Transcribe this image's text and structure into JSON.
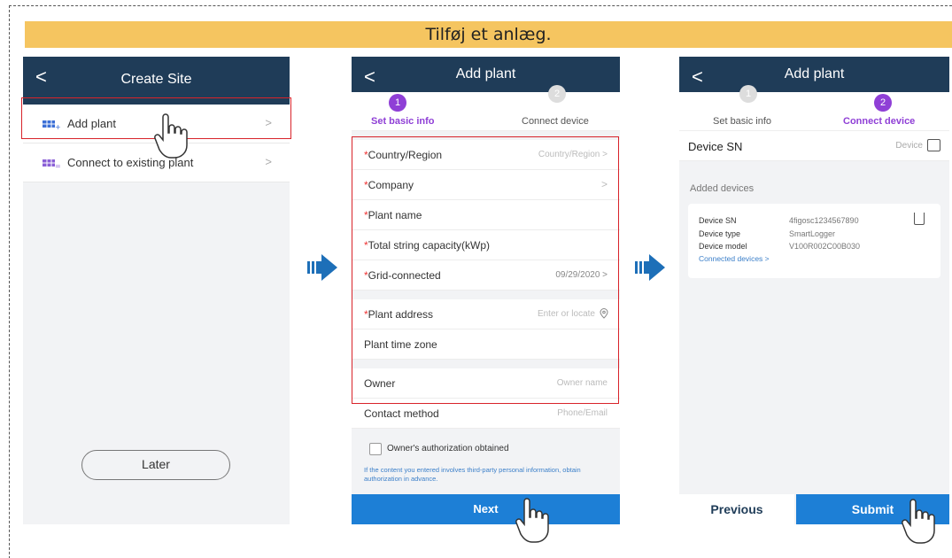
{
  "banner": "Tilføj et anlæg.",
  "screen1": {
    "title": "Create Site",
    "back": "<",
    "items": [
      {
        "label": "Add plant",
        "chev": ">"
      },
      {
        "label": "Connect to existing plant",
        "chev": ">"
      }
    ],
    "later": "Later"
  },
  "screen2": {
    "title": "Add plant",
    "back": "<",
    "step1": {
      "num": "1",
      "label": "Set basic info"
    },
    "step2": {
      "num": "2",
      "label": "Connect device"
    },
    "fields": [
      {
        "label": "Country/Region",
        "required": true,
        "value": "Country/Region >"
      },
      {
        "label": "Company",
        "required": true,
        "value": ">"
      },
      {
        "label": "Plant name",
        "required": true,
        "value": ""
      },
      {
        "label": "Total string capacity(kWp)",
        "required": true,
        "value": ""
      },
      {
        "label": "Grid-connected",
        "required": true,
        "value": "09/29/2020 >"
      },
      {
        "label": "Plant address",
        "required": true,
        "value": "Enter or locate"
      },
      {
        "label": "Plant time zone",
        "required": false,
        "value": ""
      },
      {
        "label": "Owner",
        "required": false,
        "value": "Owner name"
      },
      {
        "label": "Contact method",
        "required": false,
        "value": "Phone/Email"
      }
    ],
    "auth_label": "Owner's authorization obtained",
    "auth_note": "If the content you entered involves third-party personal information, obtain authorization in advance.",
    "next": "Next"
  },
  "screen3": {
    "title": "Add plant",
    "back": "<",
    "step1": {
      "num": "1",
      "label": "Set basic info"
    },
    "step2": {
      "num": "2",
      "label": "Connect device"
    },
    "device_sn_label": "Device SN",
    "device_sn_value": "Device",
    "added_devices": "Added devices",
    "card": {
      "sn_label": "Device SN",
      "sn_value": "4figosc1234567890",
      "type_label": "Device type",
      "type_value": "SmartLogger",
      "model_label": "Device model",
      "model_value": "V100R002C00B030",
      "link": "Connected devices >"
    },
    "previous": "Previous",
    "submit": "Submit"
  },
  "colors": {
    "navy": "#1f3c58",
    "accent": "#1d7fd6",
    "step_purple": "#8f3fd6",
    "red_box": "#d8232a",
    "banner": "#f5c560"
  }
}
